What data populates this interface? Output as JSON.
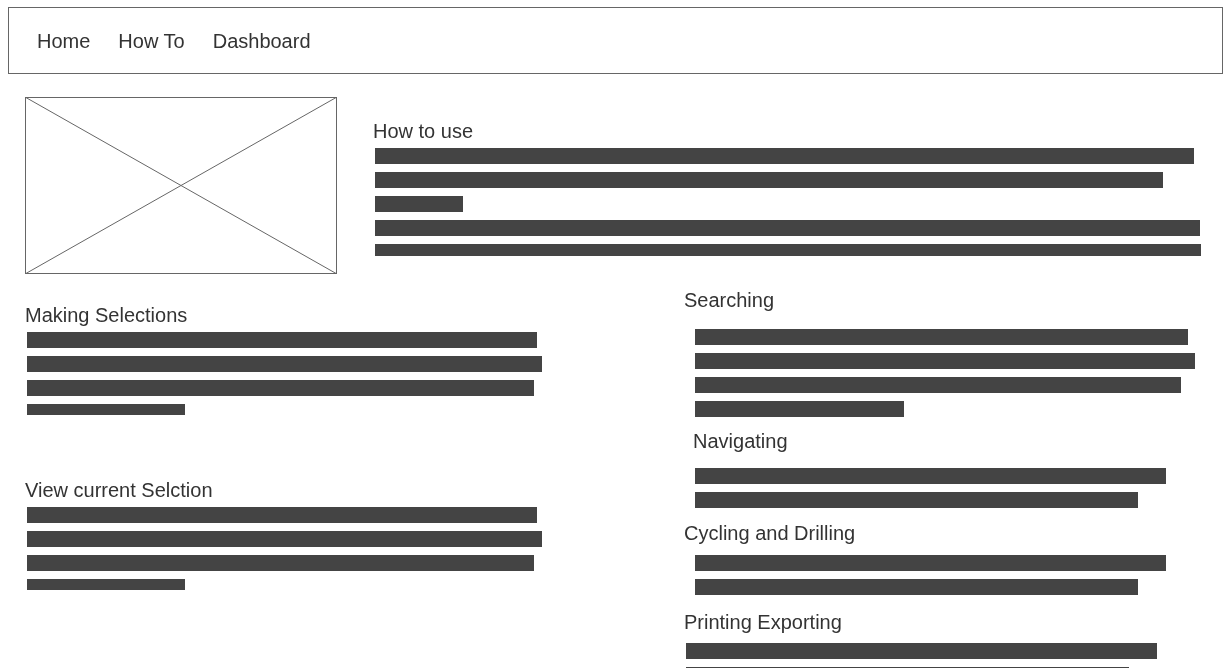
{
  "nav": {
    "items": [
      {
        "label": "Home"
      },
      {
        "label": "How To"
      },
      {
        "label": "Dashboard"
      }
    ]
  },
  "intro": {
    "image": {
      "kind": "placeholder-image"
    },
    "heading": "How to use"
  },
  "left_column": [
    {
      "heading": "Making Selections"
    },
    {
      "heading": "View current Selction"
    }
  ],
  "right_column": [
    {
      "heading": "Searching"
    },
    {
      "heading": "Navigating"
    },
    {
      "heading": "Cycling and Drilling"
    },
    {
      "heading": "Printing Exporting"
    }
  ]
}
